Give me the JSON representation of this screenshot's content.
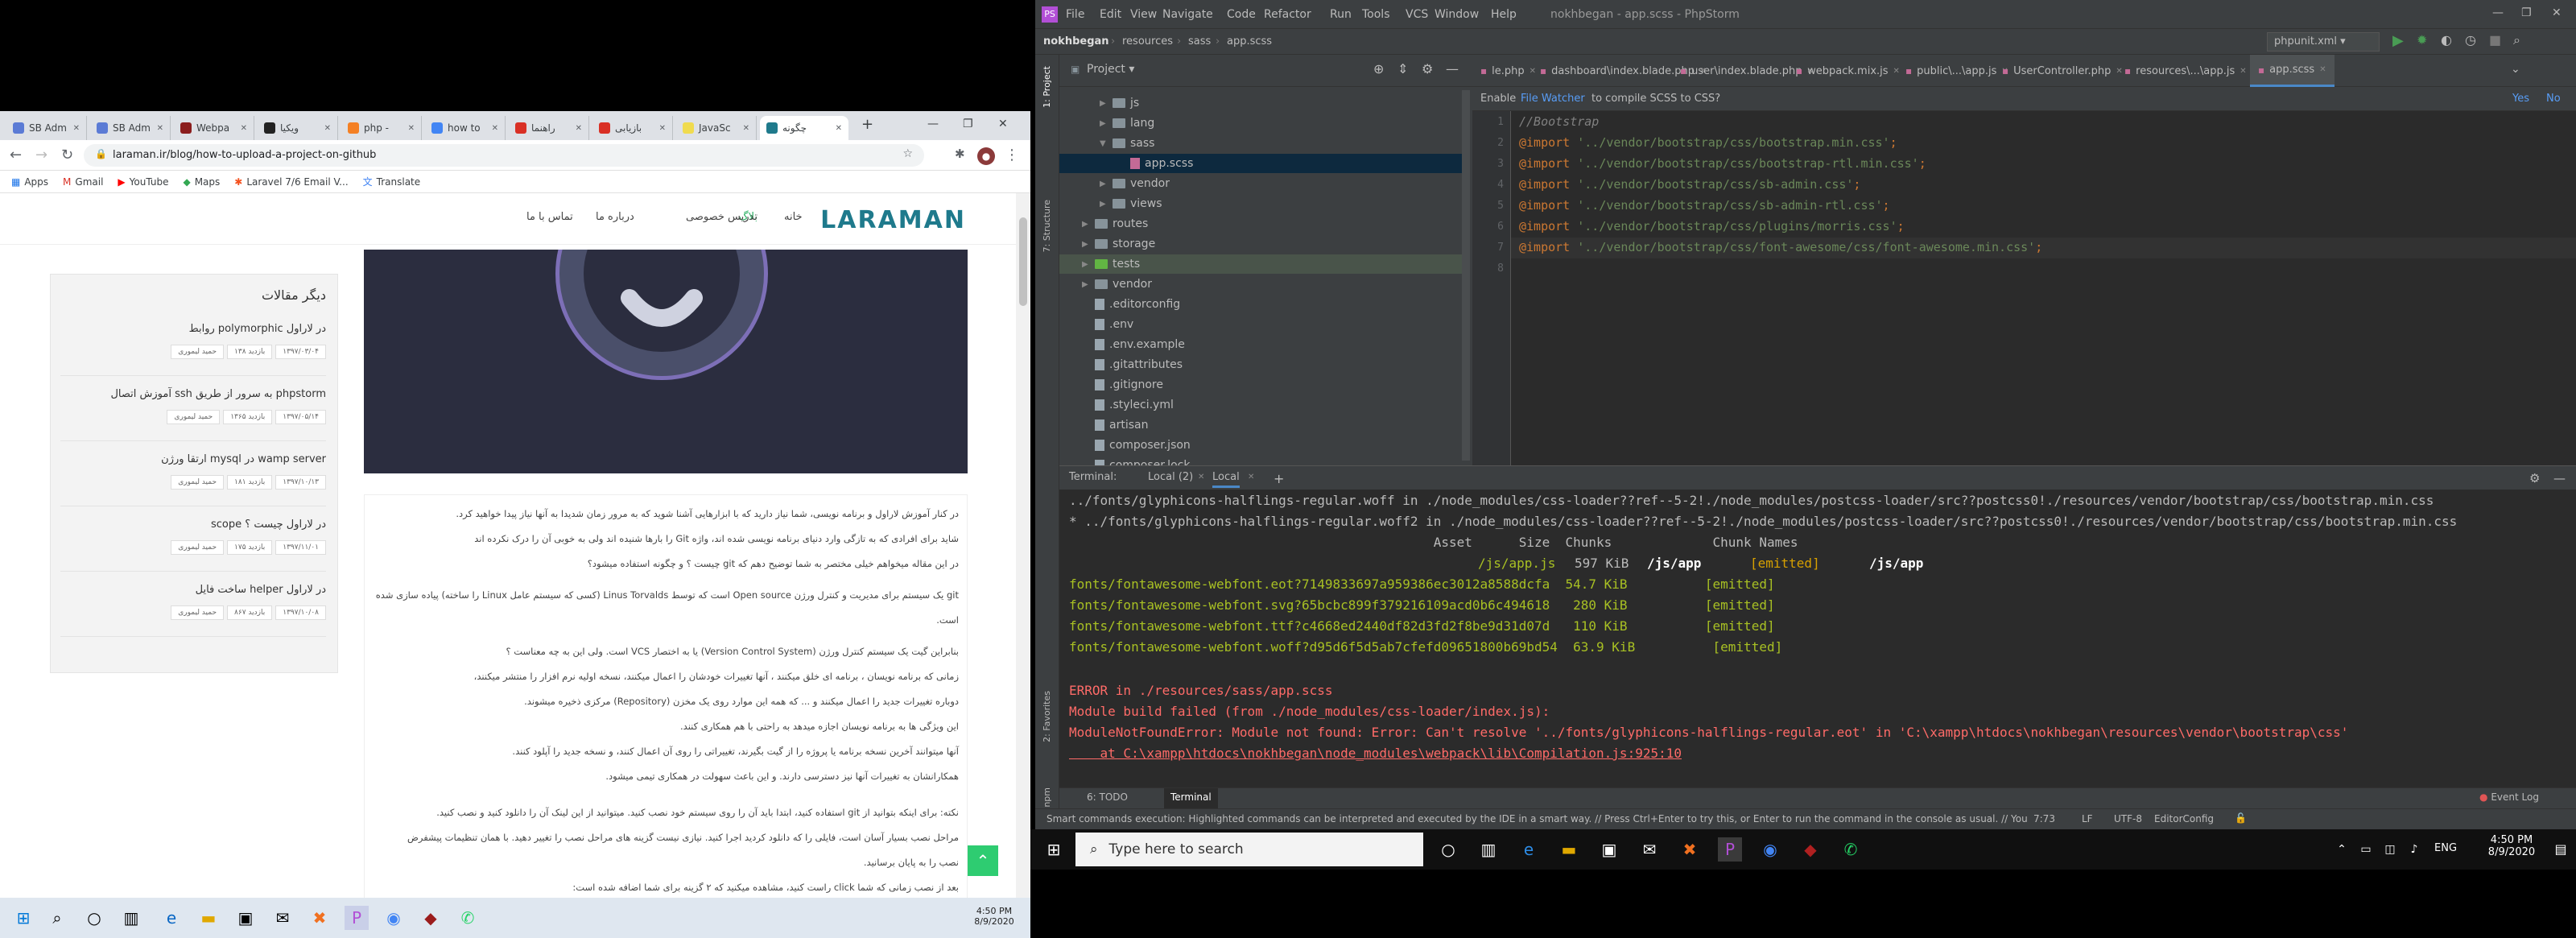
{
  "chrome": {
    "tabs": [
      {
        "label": "SB Adm",
        "color": "#5b7bd5"
      },
      {
        "label": "SB Adm",
        "color": "#5b7bd5"
      },
      {
        "label": "Webpa",
        "color": "#8b1d1d"
      },
      {
        "label": "ویکیا",
        "color": "#222"
      },
      {
        "label": "php -",
        "color": "#f48024"
      },
      {
        "label": "how to",
        "color": "#4285f4"
      },
      {
        "label": "راهنما",
        "color": "#d93025"
      },
      {
        "label": "بازیابی",
        "color": "#d93025"
      },
      {
        "label": "JavaSc",
        "color": "#f0db4f"
      },
      {
        "label": "چگونه",
        "color": "#1f7a8c"
      }
    ],
    "new_tab": "+",
    "url": "laraman.ir/blog/how-to-upload-a-project-on-github",
    "bookmarks": [
      "Apps",
      "Gmail",
      "YouTube",
      "Maps",
      "Laravel 7/6 Email V...",
      "Translate"
    ]
  },
  "site": {
    "logo": "LARAMAN",
    "nav": [
      "خانه",
      "بلاگ",
      "تدریس خصوصی",
      "درباره ما",
      "تماس با ما"
    ],
    "sidebar_title": "دیگر مقالات",
    "sidebar_items": [
      {
        "title": "روابط polymorphic در لاراول",
        "author": "حمید لیموری",
        "views": "۱۳۸ بازدید",
        "date": "۱۳۹۷/۰۳/۰۴"
      },
      {
        "title": "آموزش اتصال ssh به سرور از طریق phpstorm",
        "author": "حمید لیموری",
        "views": "۱۳۶۵ بازدید",
        "date": "۱۳۹۷/۰۵/۱۴"
      },
      {
        "title": "ارتقا ورژن mysql در wamp server",
        "author": "حمید لیموری",
        "views": "۱۸۱ بازدید",
        "date": "۱۳۹۷/۱۰/۱۳"
      },
      {
        "title": "scope در لاراول چیست ؟",
        "author": "حمید لیموری",
        "views": "۱۷۵ بازدید",
        "date": "۱۳۹۷/۱۱/۰۱"
      },
      {
        "title": "ساخت فایل helper در لاراول",
        "author": "حمید لیموری",
        "views": "۸۶۷ بازدید",
        "date": "۱۳۹۷/۱۰/۰۸"
      }
    ],
    "article": [
      "در کنار آموزش لاراول و برنامه نویسی، شما نیاز دارید که با ابزارهایی آشنا شوید که به مرور زمان شدیدا به آنها نیاز پیدا خواهید کرد.",
      "شاید برای افرادی که به تازگی وارد دنیای برنامه نویسی شده اند، واژه Git را بارها شنیده اند ولی به خوبی آن را درک نکرده اند",
      "در این مقاله میخواهم خیلی مختصر به شما توضیح دهم که git چیست ؟ و چگونه استفاده میشود؟",
      "git یک سیستم برای مدیریت و کنترل ورژن Open source است که توسط Linus Torvalds (کسی که سیستم عامل Linux را ساخته) پیاده سازی شده است.",
      "بنابراین گیت یک سیستم کنترل ورژن (Version Control System) یا به اختصار VCS است. ولی این به چه معناست ؟",
      "زمانی که برنامه نویسان ، برنامه ای خلق میکنند ، آنها تغییرات خودشان را اعمال میکنند، نسخه اولیه نرم افزار را منتشر میکنند،",
      "دوباره تغییرات جدید را اعمال میکنند و ... که همه این موارد روی یک مخزن (Repository) مرکزی ذخیره میشوند.",
      "این ویژگی ها به برنامه نویسان اجازه میدهد به راحتی با هم همکاری کنند.",
      "آنها میتوانند آخرین نسخه برنامه یا پروژه را از گیت بگیرند، تغییراتی را روی آن اعمال کنند، و نسخه جدید را آپلود کنند.",
      "همکارانشان به تغییرات آنها نیز دسترسی دارند. و این باعث سهولت در همکاری تیمی میشود.",
      "نکته: برای اینکه بتوانید از git استفاده کنید، ابتدا باید آن را روی سیستم خود نصب کنید. میتوانید از این لینک آن را دانلود کنید و نصب کنید.",
      "مراحل نصب بسیار آسان است، فایلی را که دانلود کردید اجرا کنید. نیازی نیست گزینه های مراحل نصب را تغییر دهید. با همان تنظیمات پیشفرض",
      "نصب را به پایان برسانید.",
      "بعد از نصب زمانی که شما click راست کنید، مشاهده میکنید که ۲ گزینه برای شما اضافه شده است:"
    ]
  },
  "left_taskbar": {
    "time": "4:50 PM",
    "date": "8/9/2020"
  },
  "ide": {
    "title": "nokhbegan - app.scss - PhpStorm",
    "menus": [
      "File",
      "Edit",
      "View",
      "Navigate",
      "Code",
      "Refactor",
      "Run",
      "Tools",
      "VCS",
      "Window",
      "Help"
    ],
    "breadcrumb": [
      "nokhbegan",
      "resources",
      "sass",
      "app.scss"
    ],
    "run_config": "phpunit.xml",
    "project_label": "Project",
    "tree": [
      {
        "name": "js",
        "type": "folder",
        "depth": 2,
        "arrow": "▶"
      },
      {
        "name": "lang",
        "type": "folder",
        "depth": 2,
        "arrow": "▶"
      },
      {
        "name": "sass",
        "type": "folder",
        "depth": 2,
        "arrow": "▼"
      },
      {
        "name": "app.scss",
        "type": "file",
        "depth": 3,
        "arrow": ""
      },
      {
        "name": "vendor",
        "type": "folder",
        "depth": 2,
        "arrow": "▶"
      },
      {
        "name": "views",
        "type": "folder",
        "depth": 2,
        "arrow": "▶"
      },
      {
        "name": "routes",
        "type": "folder",
        "depth": 1,
        "arrow": "▶"
      },
      {
        "name": "storage",
        "type": "folder",
        "depth": 1,
        "arrow": "▶"
      },
      {
        "name": "tests",
        "type": "folder",
        "depth": 1,
        "arrow": "▶"
      },
      {
        "name": "vendor",
        "type": "folder",
        "depth": 1,
        "arrow": "▶"
      },
      {
        "name": ".editorconfig",
        "type": "file",
        "depth": 1,
        "arrow": ""
      },
      {
        "name": ".env",
        "type": "file",
        "depth": 1,
        "arrow": ""
      },
      {
        "name": ".env.example",
        "type": "file",
        "depth": 1,
        "arrow": ""
      },
      {
        "name": ".gitattributes",
        "type": "file",
        "depth": 1,
        "arrow": ""
      },
      {
        "name": ".gitignore",
        "type": "file",
        "depth": 1,
        "arrow": ""
      },
      {
        "name": ".styleci.yml",
        "type": "file",
        "depth": 1,
        "arrow": ""
      },
      {
        "name": "artisan",
        "type": "file",
        "depth": 1,
        "arrow": ""
      },
      {
        "name": "composer.json",
        "type": "file",
        "depth": 1,
        "arrow": ""
      },
      {
        "name": "composer.lock",
        "type": "file",
        "depth": 1,
        "arrow": ""
      }
    ],
    "editor_tabs": [
      "le.php",
      "dashboard\\index.blade.php",
      "user\\index.blade.php",
      "webpack.mix.js",
      "public\\...\\app.js",
      "UserController.php",
      "resources\\...\\app.js",
      "app.scss"
    ],
    "notice": {
      "text": "Enable",
      "link": "File Watcher",
      "rest": "to compile SCSS to CSS?",
      "yes": "Yes",
      "no": "No"
    },
    "code_lines": [
      {
        "n": "1",
        "parts": [
          [
            "com",
            "//Bootstrap"
          ]
        ]
      },
      {
        "n": "2",
        "parts": [
          [
            "kw",
            "@import "
          ],
          [
            "str",
            "'../vendor/bootstrap/css/bootstrap.min.css'"
          ],
          [
            "kw",
            ";"
          ]
        ]
      },
      {
        "n": "3",
        "parts": [
          [
            "kw",
            "@import "
          ],
          [
            "str",
            "'../vendor/bootstrap/css/bootstrap-rtl.min.css'"
          ],
          [
            "kw",
            ";"
          ]
        ]
      },
      {
        "n": "4",
        "parts": [
          [
            "kw",
            "@import "
          ],
          [
            "str",
            "'../vendor/bootstrap/css/sb-admin.css'"
          ],
          [
            "kw",
            ";"
          ]
        ]
      },
      {
        "n": "5",
        "parts": [
          [
            "kw",
            "@import "
          ],
          [
            "str",
            "'../vendor/bootstrap/css/sb-admin-rtl.css'"
          ],
          [
            "kw",
            ";"
          ]
        ]
      },
      {
        "n": "6",
        "parts": [
          [
            "kw",
            "@import "
          ],
          [
            "str",
            "'../vendor/bootstrap/css/plugins/morris.css'"
          ],
          [
            "kw",
            ";"
          ]
        ]
      },
      {
        "n": "7",
        "parts": [
          [
            "kw",
            "@import "
          ],
          [
            "str",
            "'../vendor/bootstrap/css/font-awesome/css/font-awesome.min.css'"
          ],
          [
            "kw",
            ";"
          ]
        ]
      },
      {
        "n": "8",
        "parts": []
      }
    ],
    "terminal_tabs": [
      "Terminal:",
      "Local (2)",
      "Local"
    ],
    "terminal_lines": [
      {
        "c": "",
        "t": "../fonts/glyphicons-halflings-regular.woff in ./node_modules/css-loader??ref--5-2!./node_modules/postcss-loader/src??postcss0!./resources/vendor/bootstrap/css/bootstrap.min.css"
      },
      {
        "c": "",
        "t": "* ../fonts/glyphicons-halflings-regular.woff2 in ./node_modules/css-loader??ref--5-2!./node_modules/postcss-loader/src??postcss0!./resources/vendor/bootstrap/css/bootstrap.min.css"
      },
      {
        "c": "",
        "t": "                                               Asset      Size  Chunks             Chunk Names"
      },
      {
        "c": "mix",
        "t": ""
      },
      {
        "c": "grn",
        "t": "fonts/fontawesome-webfont.eot?7149833697a959386ec3012a8588dcfa  54.7 KiB          [emitted]"
      },
      {
        "c": "grn",
        "t": "fonts/fontawesome-webfont.svg?65bcbc899f379216109acd0b6c494618   280 KiB          [emitted]"
      },
      {
        "c": "grn",
        "t": "fonts/fontawesome-webfont.ttf?c4668ed2440df82d3fd2f8be9d31d07d   110 KiB          [emitted]"
      },
      {
        "c": "grn",
        "t": "fonts/fontawesome-webfont.woff?d95d6f5d5ab7cfefd09651800b69bd54  63.9 KiB          [emitted]"
      },
      {
        "c": "",
        "t": ""
      },
      {
        "c": "red",
        "t": "ERROR in ./resources/sass/app.scss"
      },
      {
        "c": "red",
        "t": "Module build failed (from ./node_modules/css-loader/index.js):"
      },
      {
        "c": "red",
        "t": "ModuleNotFoundError: Module not found: Error: Can't resolve '../fonts/glyphicons-halflings-regular.eot' in 'C:\\xampp\\htdocs\\nokhbegan\\resources\\vendor\\bootstrap\\css'"
      },
      {
        "c": "redlink",
        "t": "    at C:\\xampp\\htdocs\\nokhbegan\\node_modules\\webpack\\lib\\Compilation.js:925:10"
      }
    ],
    "app_js_row": {
      "name": "/js/app.js",
      "size": "597 KiB",
      "chunk": "/js/app",
      "status": "[emitted]",
      "names": "/js/app"
    },
    "bottom_tabs": [
      "6: TODO",
      "Terminal"
    ],
    "event_log": "Event Log",
    "status_text": "Smart commands execution: Highlighted commands can be interpreted and executed by the IDE in a smart way. // Press Ctrl+Enter to try this, or Enter to run the command in the console as usual. // You can turn this behavior on/off i... (a minu",
    "status_pos": "7:73",
    "status_lf": "LF",
    "status_enc": "UTF-8",
    "status_cfg": "EditorConfig"
  },
  "right_taskbar": {
    "search": "Type here to search",
    "lang": "ENG",
    "time": "4:50 PM",
    "date": "8/9/2020"
  }
}
